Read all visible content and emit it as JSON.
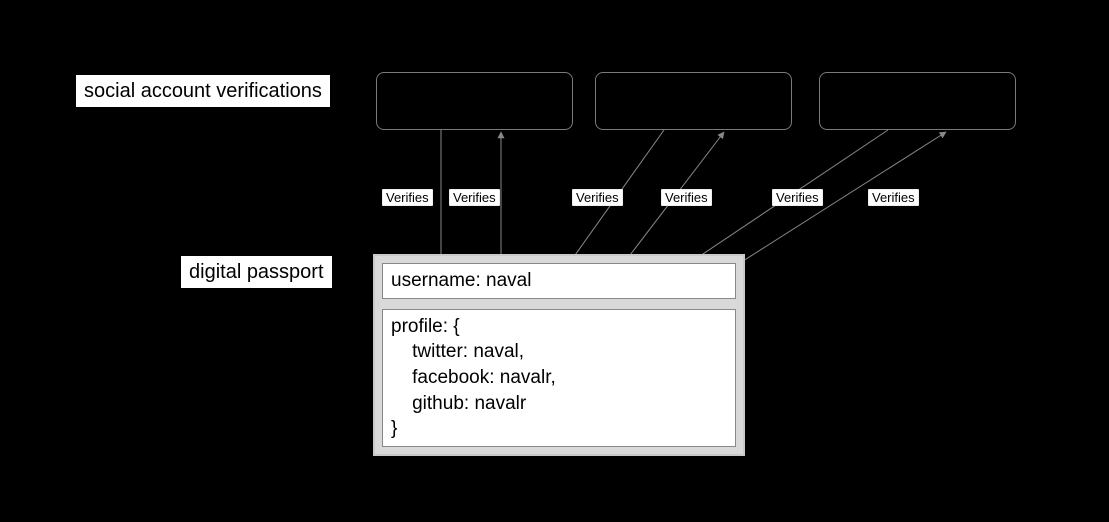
{
  "labels": {
    "social_verifications": "social account verifications",
    "digital_passport": "digital passport"
  },
  "edge_label": "Verifies",
  "passport": {
    "username_line": "username: naval",
    "profile_block": "profile: {\n    twitter: naval,\n    facebook: navalr,\n    github: navalr\n}"
  }
}
